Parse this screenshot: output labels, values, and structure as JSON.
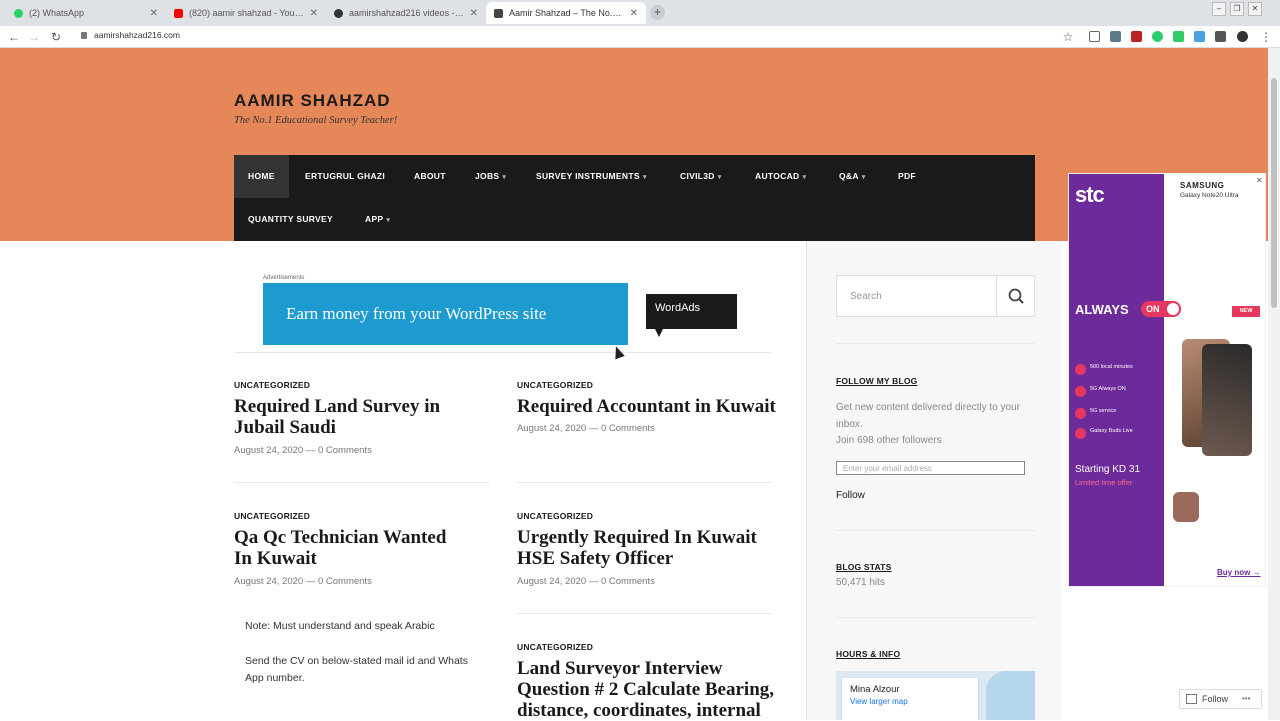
{
  "browser": {
    "tabs": [
      {
        "title": "(2) WhatsApp",
        "color": "#25d366"
      },
      {
        "title": "(820) aamir shahzad - YouTube",
        "color": "#ff0000"
      },
      {
        "title": "aamirshahzad216 videos - daily",
        "color": "#333333"
      },
      {
        "title": "Aamir Shahzad – The No.1 Educa",
        "color": "#444444"
      }
    ],
    "new_tab": "+",
    "close_glyph": "✕",
    "url": "aamirshahzad216.com",
    "back": "←",
    "forward": "→",
    "reload": "↻",
    "star": "☆",
    "menu": "⋮"
  },
  "site": {
    "title": "AAMIR SHAHZAD",
    "tagline": "The No.1 Educational Survey Teacher!"
  },
  "nav": {
    "row1": [
      {
        "label": "HOME"
      },
      {
        "label": "ERTUGRUL GHAZI"
      },
      {
        "label": "ABOUT"
      },
      {
        "label": "JOBS",
        "caret": "▾"
      },
      {
        "label": "SURVEY INSTRUMENTS",
        "caret": "▾"
      },
      {
        "label": "CIVIL3D",
        "caret": "▾"
      },
      {
        "label": "AUTOCAD",
        "caret": "▾"
      },
      {
        "label": "Q&A",
        "caret": "▾"
      },
      {
        "label": "PDF"
      }
    ],
    "row2": [
      {
        "label": "QUANTITY SURVEY"
      },
      {
        "label": "APP",
        "caret": "▾"
      }
    ]
  },
  "ad": {
    "label": "Advertisements",
    "banner": "Earn money from your WordPress site",
    "bubble": "WordAds"
  },
  "posts": [
    {
      "category": "UNCATEGORIZED",
      "title": "Required Land Survey in Jubail Saudi",
      "meta": "August 24, 2020 — 0 Comments"
    },
    {
      "category": "UNCATEGORIZED",
      "title": "Required Accountant in Kuwait",
      "meta": "August 24, 2020 — 0 Comments"
    },
    {
      "category": "UNCATEGORIZED",
      "title": "Qa Qc Technician Wanted In Kuwait",
      "meta": "August 24, 2020 — 0 Comments"
    },
    {
      "category": "UNCATEGORIZED",
      "title": "Urgently Required In Kuwait HSE Safety Officer",
      "meta": "August 24, 2020 — 0 Comments"
    },
    {
      "category": "UNCATEGORIZED",
      "title": "Land Surveyor Interview Question # 2 Calculate Bearing, distance, coordinates, internal"
    }
  ],
  "excerpt": {
    "line1": "Note: Must understand and speak Arabic",
    "line2": "Send the CV on below-stated mail id and Whats App number."
  },
  "sidebar": {
    "search_placeholder": "Search",
    "follow_title": "FOLLOW MY BLOG",
    "follow_text": "Get new content delivered directly to your inbox.",
    "followers": "Join 698 other followers",
    "email_placeholder": "Enter your email address",
    "follow_button": "Follow",
    "stats_title": "BLOG STATS",
    "stats_value": "50,471 hits",
    "hours_title": "HOURS & INFO",
    "map_name": "Mina Alzour",
    "map_link": "View larger map"
  },
  "side_ad": {
    "logo": "stc",
    "brand": "SAMSUNG",
    "model": "Galaxy Note20 Ultra",
    "always": "ALWAYS",
    "on": "ON",
    "new": "NEW",
    "bullets": [
      "500 local minutes",
      "5G Always ON",
      "5G service",
      "Galaxy Buds Live"
    ],
    "starting": "Starting KD 31",
    "limited": "Limited time offer",
    "buy": "Buy now →",
    "close": "✕"
  },
  "follow_float": "Follow",
  "float_menu": "•••",
  "colors": {
    "header": "#e6875a",
    "nav": "#1a1a1a",
    "ad_banner": "#1d9bd1",
    "stc": "#6c2a9b"
  }
}
